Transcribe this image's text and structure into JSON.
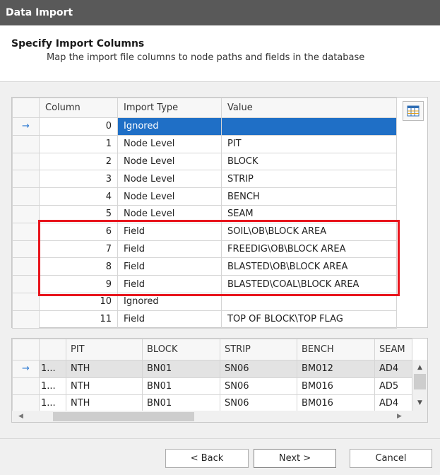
{
  "window": {
    "title": "Data Import"
  },
  "header": {
    "title": "Specify Import Columns",
    "subtitle": "Map the import file columns to node paths and fields in the database"
  },
  "mapping_grid": {
    "columns": [
      "Column",
      "Import Type",
      "Value"
    ],
    "rows": [
      {
        "column": "0",
        "import_type": "Ignored",
        "value": ""
      },
      {
        "column": "1",
        "import_type": "Node Level",
        "value": "PIT"
      },
      {
        "column": "2",
        "import_type": "Node Level",
        "value": "BLOCK"
      },
      {
        "column": "3",
        "import_type": "Node Level",
        "value": "STRIP"
      },
      {
        "column": "4",
        "import_type": "Node Level",
        "value": "BENCH"
      },
      {
        "column": "5",
        "import_type": "Node Level",
        "value": "SEAM"
      },
      {
        "column": "6",
        "import_type": "Field",
        "value": "SOIL\\OB\\BLOCK AREA"
      },
      {
        "column": "7",
        "import_type": "Field",
        "value": "FREEDIG\\OB\\BLOCK AREA"
      },
      {
        "column": "8",
        "import_type": "Field",
        "value": "BLASTED\\OB\\BLOCK AREA"
      },
      {
        "column": "9",
        "import_type": "Field",
        "value": "BLASTED\\COAL\\BLOCK AREA"
      },
      {
        "column": "10",
        "import_type": "Ignored",
        "value": ""
      },
      {
        "column": "11",
        "import_type": "Field",
        "value": "TOP OF BLOCK\\TOP FLAG"
      }
    ],
    "current_row_indicator": "→",
    "column_chooser_icon": "grid-columns-icon"
  },
  "preview_grid": {
    "columns": [
      "",
      "PIT",
      "BLOCK",
      "STRIP",
      "BENCH",
      "SEAM"
    ],
    "rows": [
      {
        "rn": "1...",
        "cells": [
          "NTH",
          "BN01",
          "SN06",
          "BM012",
          "AD4"
        ]
      },
      {
        "rn": "1...",
        "cells": [
          "NTH",
          "BN01",
          "SN06",
          "BM016",
          "AD5"
        ]
      },
      {
        "rn": "1...",
        "cells": [
          "NTH",
          "BN01",
          "SN06",
          "BM016",
          "AD4"
        ]
      }
    ],
    "current_row_indicator": "→"
  },
  "buttons": {
    "back": "< Back",
    "next": "Next >",
    "cancel": "Cancel"
  },
  "colors": {
    "titlebar": "#595959",
    "selection": "#1f6fc6",
    "highlight_box": "#e8141c"
  }
}
